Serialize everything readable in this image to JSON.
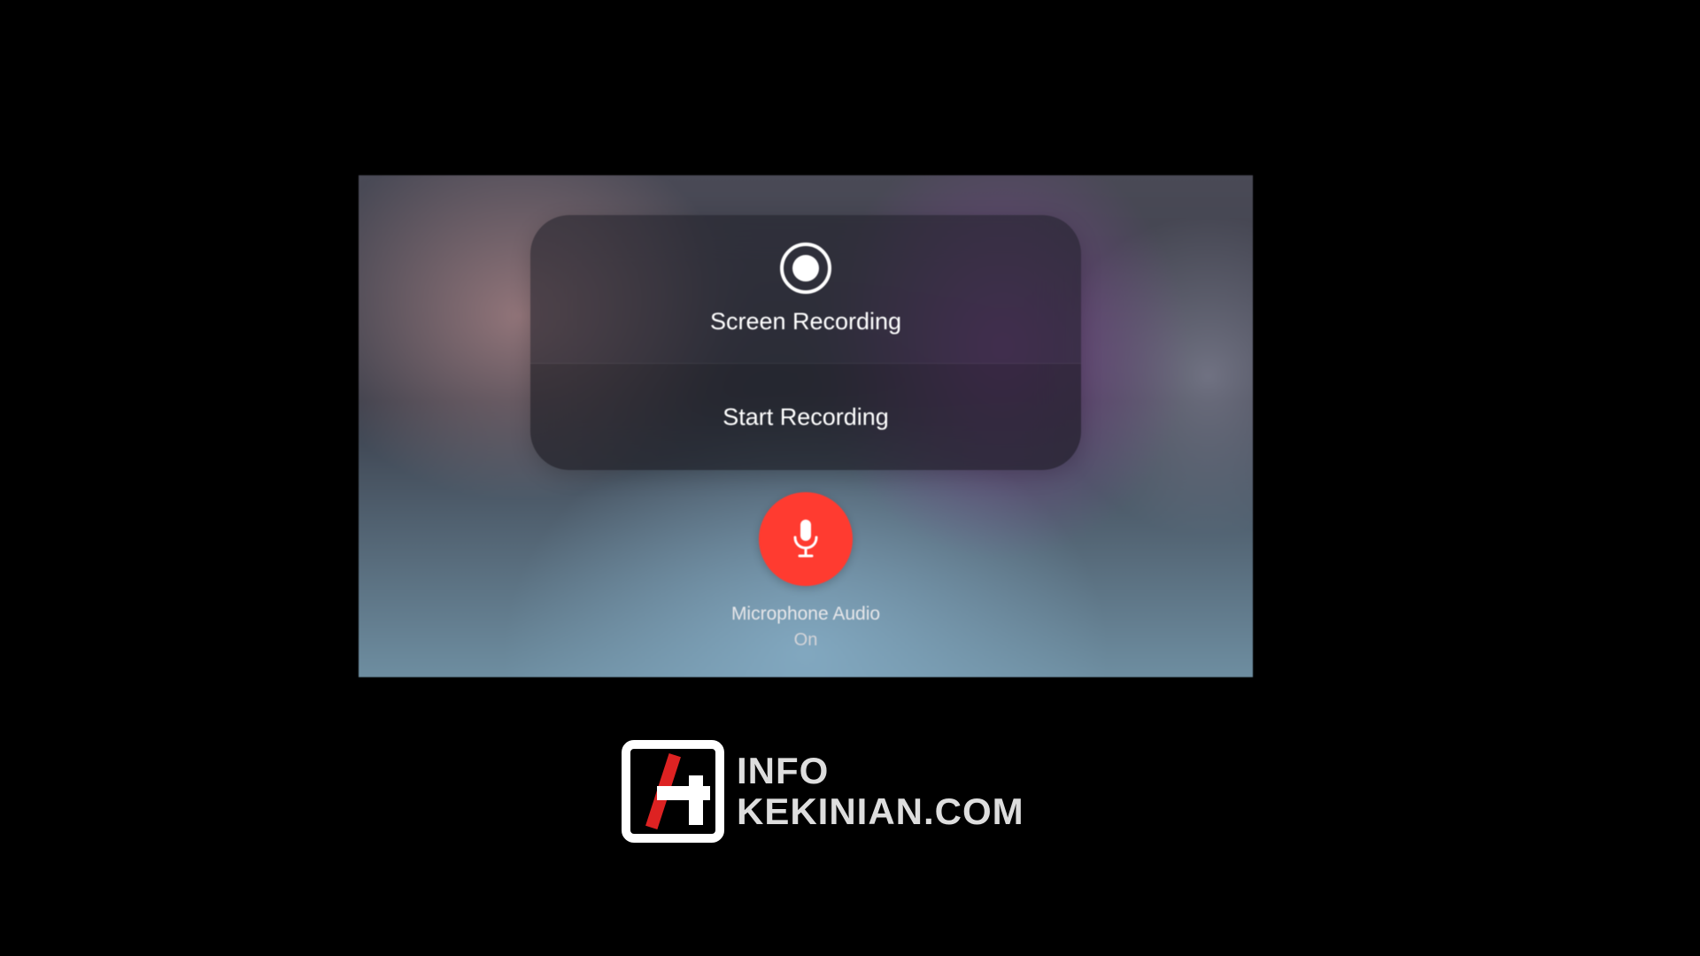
{
  "panel": {
    "title": "Screen Recording",
    "action": "Start Recording"
  },
  "microphone": {
    "label": "Microphone Audio",
    "status": "On",
    "active_color": "#ff3b30"
  },
  "watermark": {
    "line1": "INFO",
    "line2": "KEKINIAN.COM"
  }
}
